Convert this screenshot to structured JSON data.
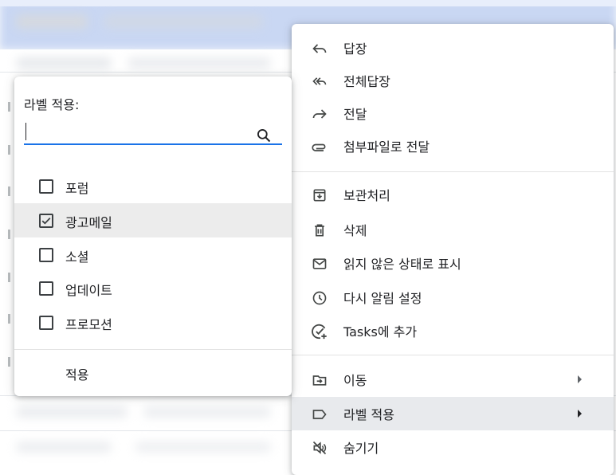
{
  "context_menu": {
    "items": [
      {
        "label": "답장",
        "icon": "reply-icon"
      },
      {
        "label": "전체답장",
        "icon": "reply-all-icon"
      },
      {
        "label": "전달",
        "icon": "forward-icon"
      },
      {
        "label": "첨부파일로 전달",
        "icon": "attachment-icon"
      },
      {
        "label": "보관처리",
        "icon": "archive-icon"
      },
      {
        "label": "삭제",
        "icon": "trash-icon"
      },
      {
        "label": "읽지 않은 상태로 표시",
        "icon": "mail-unread-icon"
      },
      {
        "label": "다시 알림 설정",
        "icon": "clock-icon"
      },
      {
        "label": "Tasks에 추가",
        "icon": "add-task-icon"
      },
      {
        "label": "이동",
        "icon": "move-to-icon"
      },
      {
        "label": "라벨 적용",
        "icon": "label-icon"
      },
      {
        "label": "숨기기",
        "icon": "mute-icon"
      }
    ]
  },
  "label_popup": {
    "title": "라벨 적용:",
    "search_value": "",
    "labels": [
      {
        "name": "포럼",
        "checked": false
      },
      {
        "name": "광고메일",
        "checked": true
      },
      {
        "name": "소셜",
        "checked": false
      },
      {
        "name": "업데이트",
        "checked": false
      },
      {
        "name": "프로모션",
        "checked": false
      }
    ],
    "apply_label": "적용"
  }
}
